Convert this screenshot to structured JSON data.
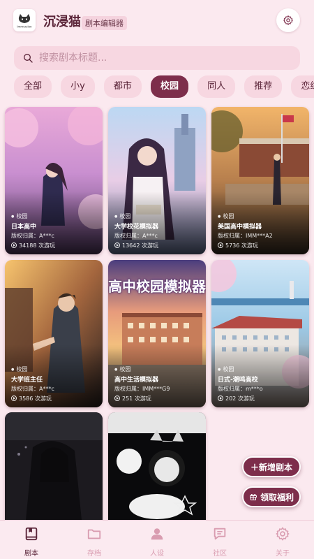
{
  "header": {
    "title": "沉浸猫",
    "badge": "剧本编辑器",
    "logo_alt": "immersion"
  },
  "search": {
    "placeholder": "搜索剧本标题..."
  },
  "tabs": [
    {
      "label": "全部",
      "active": false
    },
    {
      "label": "小y",
      "active": false
    },
    {
      "label": "都市",
      "active": false
    },
    {
      "label": "校园",
      "active": true
    },
    {
      "label": "同人",
      "active": false
    },
    {
      "label": "推荐",
      "active": false
    },
    {
      "label": "恋综",
      "active": false
    }
  ],
  "cards": [
    {
      "tag": "校园",
      "name": "日本高中",
      "owner": "版权归属：A***c",
      "plays": "34188 次游玩"
    },
    {
      "tag": "校园",
      "name": "大学校花模拟器",
      "owner": "版权归属：A***c",
      "plays": "13642 次游玩"
    },
    {
      "tag": "校园",
      "name": "美国高中模拟器",
      "owner": "版权归属：IMM***A2",
      "plays": "5736 次游玩"
    },
    {
      "tag": "校园",
      "name": "大学班主任",
      "owner": "版权归属：A***c",
      "plays": "3586 次游玩"
    },
    {
      "tag": "校园",
      "name": "高中生活模拟器",
      "owner": "版权归属：IMM***G9",
      "plays": "251 次游玩",
      "overlay": "高中校园模拟器"
    },
    {
      "tag": "校园",
      "name": "日式-潮鸣高校",
      "owner": "版权归属：m***o",
      "plays": "202 次游玩"
    },
    {
      "tag": "",
      "name": "",
      "owner": "",
      "plays": ""
    },
    {
      "tag": "",
      "name": "",
      "owner": "",
      "plays": ""
    }
  ],
  "fabs": {
    "add_script": "＋新增剧本",
    "claim_bonus": "领取福利"
  },
  "bottom_nav": [
    {
      "label": "剧本",
      "icon": "book-icon",
      "active": true
    },
    {
      "label": "存档",
      "icon": "folder-icon",
      "active": false
    },
    {
      "label": "人设",
      "icon": "person-icon",
      "active": false
    },
    {
      "label": "社区",
      "icon": "chat-icon",
      "active": false
    },
    {
      "label": "关于",
      "icon": "gear-icon",
      "active": false
    }
  ],
  "colors": {
    "background": "#fbe9ef",
    "accent": "#7d2e4b",
    "chip": "#f7d7e1"
  }
}
